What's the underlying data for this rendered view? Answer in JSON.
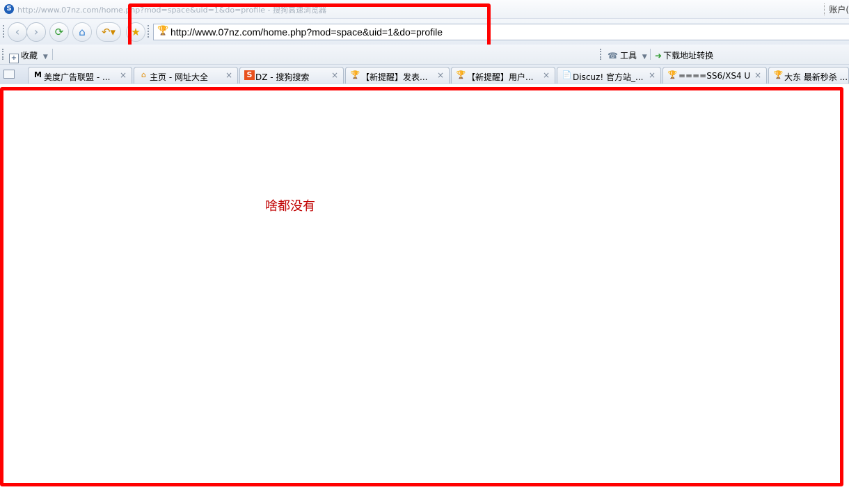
{
  "window": {
    "title": "http://www.07nz.com/home.php?mod=space&uid=1&do=profile - 搜狗高速浏览器",
    "account_label": "账户("
  },
  "toolbar": {
    "back_icon": "back-arrow-icon",
    "forward_icon": "forward-arrow-icon",
    "refresh_icon": "refresh-icon",
    "home_icon": "home-icon",
    "undo_icon": "undo-icon",
    "favorite_icon": "star-icon"
  },
  "address_bar": {
    "url": "http://www.07nz.com/home.php?mod=space&uid=1&do=profile"
  },
  "bookmarks": {
    "favorites_label": "收藏",
    "tools_label": "工具",
    "download_convert_label": "下载地址转换"
  },
  "tabs": [
    {
      "label": "美度广告联盟 - ...",
      "icon": "M"
    },
    {
      "label": "主页 - 网址大全",
      "icon": "⌂"
    },
    {
      "label": "DZ - 搜狗搜索",
      "icon": "S"
    },
    {
      "label": "【新提醒】发表...",
      "icon": "🏆"
    },
    {
      "label": "【新提醒】用户...",
      "icon": "🏆"
    },
    {
      "label": "Discuz! 官方站_...",
      "icon": "📄"
    },
    {
      "label": "====SS6/XS4 U...",
      "icon": "🏆"
    },
    {
      "label": "大东 最新秒杀 ...",
      "icon": "🏆"
    }
  ],
  "content": {
    "message": "啥都没有"
  },
  "colors": {
    "highlight_box": "#ff0000",
    "message_text": "#c00000"
  }
}
